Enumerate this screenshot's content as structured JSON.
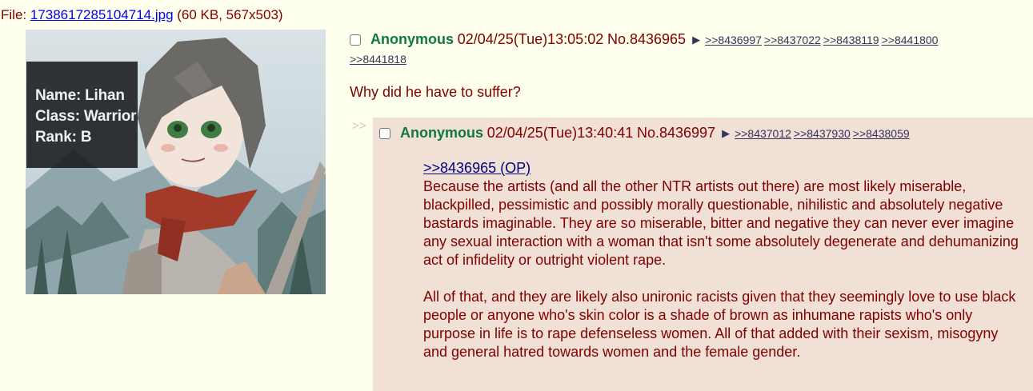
{
  "file": {
    "prefix": "File: ",
    "filename": "1738617285104714.jpg",
    "meta": " (60 KB, 567x503)"
  },
  "thumbnail": {
    "info_lines": [
      "Name: Lihan",
      "Class: Warrior",
      "Rank: B"
    ]
  },
  "op": {
    "name": "Anonymous",
    "datetime": "02/04/25(Tue)13:05:02",
    "post_no": "No.8436965",
    "backlinks": [
      ">>8436997",
      ">>8437022",
      ">>8438119",
      ">>8441800",
      ">>8441818"
    ],
    "message": "Why did he have to suffer?"
  },
  "reply": {
    "side_arrows": ">>",
    "name": "Anonymous",
    "datetime": "02/04/25(Tue)13:40:41",
    "post_no": "No.8436997",
    "backlinks": [
      ">>8437012",
      ">>8437930",
      ">>8438059"
    ],
    "quote": ">>8436965 (OP)",
    "paragraph1": "Because the artists (and all the other NTR artists out there) are most likely miserable, blackpilled, pessimistic and possibly morally questionable, nihilistic and absolutely negative bastards imaginable. They are so miserable, bitter and negative they can never ever imagine any sexual interaction with a woman that isn't some absolutely degenerate and dehumanizing act of infidelity or outright violent rape.",
    "paragraph2": "All of that, and they are likely also unironic racists given that they seemingly love to use black people or anyone who's skin color is a shade of brown as inhumane rapists who's only purpose in life is to rape defenseless women. All of that added with their sexism, misogyny and general hatred towards women and the female gender."
  },
  "colors": {
    "background": "#ffffee",
    "text": "#800000",
    "name": "#117743",
    "reply_bg": "#f0e0d6",
    "link": "#34345c"
  }
}
